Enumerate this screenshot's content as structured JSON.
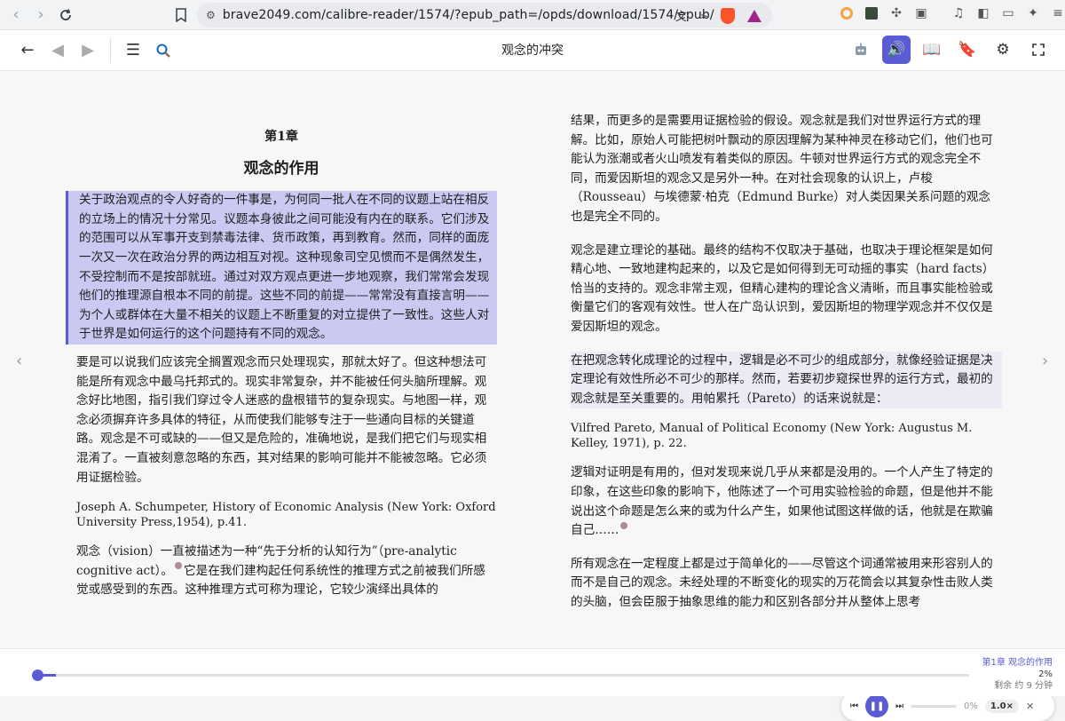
{
  "browser": {
    "url": "brave2049.com/calibre-reader/1574/?epub_path=/opds/download/1574/epub/"
  },
  "reader": {
    "title": "观念的冲突"
  },
  "left_column": {
    "chapter_no": "第1章",
    "chapter_title": "观念的作用",
    "p1": "关于政治观点的令人好奇的一件事是，为何同一批人在不同的议题上站在相反的立场上的情况十分常见。议题本身彼此之间可能没有内在的联系。它们涉及的范围可以从军事开支到禁毒法律、货币政策，再到教育。然而，同样的面庞一次又一次在政治分界的两边相互对视。这种现象司空见惯而不是偶然发生，不受控制而不是按部就班。通过对双方观点更进一步地观察，我们常常会发现他们的推理源自根本不同的前提。这些不同的前提——常常没有直接言明——为个人或群体在大量不相关的议题上不断重复的对立提供了一致性。这些人对于世界是如何运行的这个问题持有不同的观念。",
    "p2": "要是可以说我们应该完全搁置观念而只处理现实，那就太好了。但这种想法可能是所有观念中最乌托邦式的。现实非常复杂，并不能被任何头脑所理解。观念好比地图，指引我们穿过令人迷惑的盘根错节的复杂现实。与地图一样，观念必须摒弃许多具体的特征，从而使我们能够专注于一些通向目标的关键道路。观念是不可或缺的——但又是危险的，准确地说，是我们把它们与现实相混淆了。一直被刻意忽略的东西，其对结果的影响可能并不能被忽略。它必须用证据检验。",
    "ref1": "Joseph A. Schumpeter, History of Economic Analysis (New York: Oxford University Press,1954), p.41.",
    "p3a": "观念（vision）一直被描述为一种“先于分析的认知行为”（pre-analytic cognitive act）。",
    "p3b": "它是在我们建构起任何系统性的推理方式之前被我们所感觉或感受到的东西。这种推理方式可称为理论，它较少演绎出具体的"
  },
  "right_column": {
    "p1": "结果，而更多的是需要用证据检验的假设。观念就是我们对世界运行方式的理解。比如，原始人可能把树叶飘动的原因理解为某种神灵在移动它们，他们也可能认为涨潮或者火山喷发有着类似的原因。牛顿对世界运行方式的观念完全不同，而爱因斯坦的观念又是另外一种。在对社会现象的认识上，卢梭（Rousseau）与埃德蒙·柏克（Edmund Burke）对人类因果关系问题的观念也是完全不同的。",
    "p2": "观念是建立理论的基础。最终的结构不仅取决于基础，也取决于理论框架是如何精心地、一致地建构起来的，以及它是如何得到无可动摇的事实（hard facts）恰当的支持的。观念非常主观，但精心建构的理论含义清晰，而且事实能检验或衡量它们的客观有效性。世人在广岛认识到，爱因斯坦的物理学观念并不仅仅是爱因斯坦的观念。",
    "p3": "在把观念转化成理论的过程中，逻辑是必不可少的组成部分，就像经验证据是决定理论有效性所必不可少的那样。然而，若要初步窥探世界的运行方式，最初的观念就是至关重要的。用帕累托（Pareto）的话来说就是：",
    "ref2": "Vilfred Pareto, Manual of Political Economy (New York: Augustus M. Kelley, 1971), p. 22.",
    "p4": "逻辑对证明是有用的，但对发现来说几乎从来都是没用的。一个人产生了特定的印象，在这些印象的影响下，他陈述了一个可用实验检验的命题，但是他并不能说出这个命题是怎么来的或为什么产生，如果他试图这样做的话，他就是在欺骗自己……",
    "p5": "所有观念在一定程度上都是过于简单化的——尽管这个词通常被用来形容别人的而不是自己的观念。未经处理的不断变化的现实的万花筒会以其复杂性击败人类的头脑，但会臣服于抽象思维的能力和区别各部分并从整体上思考"
  },
  "player": {
    "percent": "0%",
    "speed": "1.0×"
  },
  "bottom": {
    "chapter": "第1章 观念的作用",
    "progress_text": "2%",
    "progress_value": 0.02,
    "remaining": "剩余 约 9 分钟"
  },
  "colors": {
    "accent": "#5b5bd6",
    "highlight": "#c9c9f2"
  }
}
